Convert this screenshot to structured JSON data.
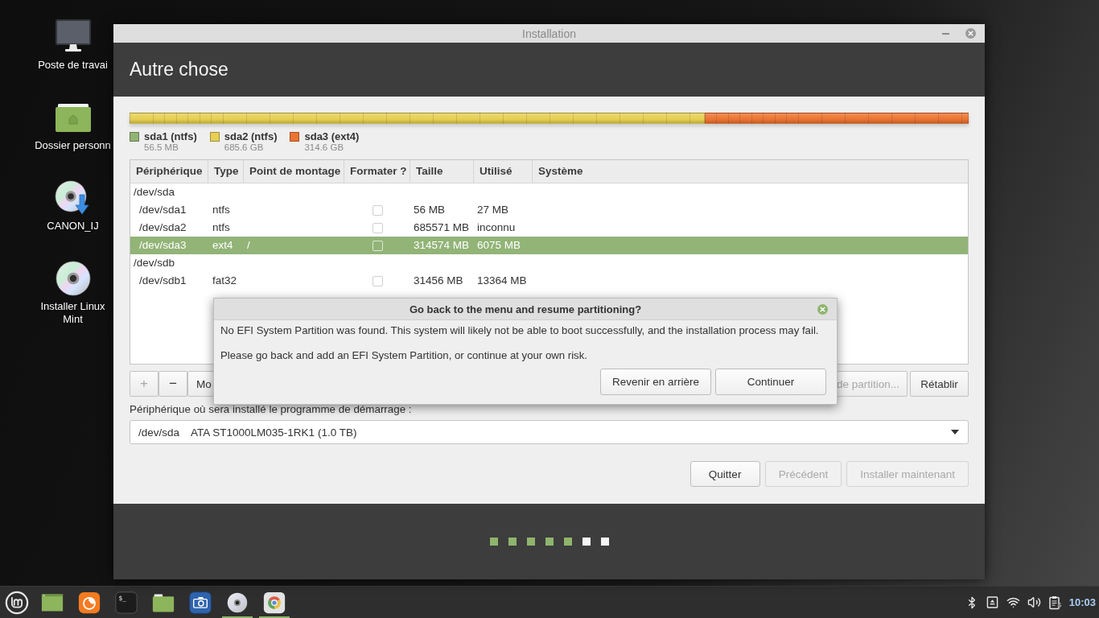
{
  "desktop_icons": [
    {
      "kind": "computer",
      "label": "Poste de travai"
    },
    {
      "kind": "home-folder",
      "label": "Dossier personn"
    },
    {
      "kind": "disc-download",
      "label": "CANON_IJ"
    },
    {
      "kind": "disc",
      "label": "Installer Linux Mint"
    }
  ],
  "window": {
    "title": "Installation",
    "heading": "Autre chose"
  },
  "partitions": [
    {
      "name": "sda1 (ntfs)",
      "size": "56.5 MB",
      "color": "#93b374",
      "level": 0.0001
    },
    {
      "name": "sda2 (ntfs)",
      "size": "685.6 GB",
      "color": "#e6cf52",
      "level": 0.6855
    },
    {
      "name": "sda3 (ext4)",
      "size": "314.6 GB",
      "color": "#ec7431",
      "level": 0.3144
    }
  ],
  "table": {
    "columns": [
      "Périphérique",
      "Type",
      "Point de montage",
      "Formater ?",
      "Taille",
      "Utilisé",
      "Système"
    ],
    "rows": [
      {
        "kind": "disk",
        "device": "/dev/sda",
        "selected": false
      },
      {
        "kind": "partition",
        "device": "/dev/sda1",
        "type": "ntfs",
        "format": false,
        "size": "56 MB",
        "used": "27 MB",
        "selected": false
      },
      {
        "kind": "partition",
        "device": "/dev/sda2",
        "type": "ntfs",
        "format": false,
        "size": "685571 MB",
        "used": "inconnu",
        "selected": false
      },
      {
        "kind": "partition",
        "device": "/dev/sda3",
        "type": "ext4",
        "mount": "/",
        "format": false,
        "size": "314574 MB",
        "used": "6075 MB",
        "selected": true
      },
      {
        "kind": "disk",
        "device": "/dev/sdb",
        "selected": false
      },
      {
        "kind": "partition",
        "device": "/dev/sdb1",
        "type": "fat32",
        "format": false,
        "size": "31456 MB",
        "used": "13364 MB",
        "selected": false
      }
    ]
  },
  "toolbar": {
    "left": [
      {
        "label": "+",
        "disabled": true
      },
      {
        "label": "−",
        "disabled": false
      },
      {
        "label": "Mo",
        "disabled": false
      }
    ],
    "right": [
      {
        "label": "de partition...",
        "disabled": true
      },
      {
        "label": "Rétablir",
        "disabled": false
      }
    ]
  },
  "bootloader": {
    "label": "Périphérique où sera installé le programme de démarrage :",
    "device": "/dev/sda",
    "description": "ATA ST1000LM035-1RK1 (1.0 TB)"
  },
  "actions": [
    {
      "label": "Quitter",
      "disabled": false
    },
    {
      "label": "Précédent",
      "disabled": true
    },
    {
      "label": "Installer maintenant",
      "disabled": true
    }
  ],
  "steps": [
    {
      "done": true
    },
    {
      "done": true
    },
    {
      "done": true
    },
    {
      "done": true
    },
    {
      "done": true
    },
    {
      "done": false
    },
    {
      "done": false
    }
  ],
  "dialog": {
    "title": "Go back to the menu and resume partitioning?",
    "messages": [
      "No EFI System Partition was found. This system will likely not be able to boot successfully, and the installation process may fail.",
      "Please go back and add an EFI System Partition, or continue at your own risk."
    ],
    "buttons": [
      {
        "label": "Revenir en arrière"
      },
      {
        "label": "Continuer"
      }
    ]
  },
  "taskbar": {
    "launchers": [
      {
        "kind": "show-desktop",
        "running": false
      },
      {
        "kind": "browser",
        "running": false
      },
      {
        "kind": "terminal",
        "glyph": "$_",
        "running": false
      },
      {
        "kind": "folder",
        "running": false
      },
      {
        "kind": "camera",
        "running": false
      },
      {
        "kind": "disc",
        "running": true
      },
      {
        "kind": "color-wheel",
        "running": true
      }
    ],
    "clock": "10:03"
  }
}
